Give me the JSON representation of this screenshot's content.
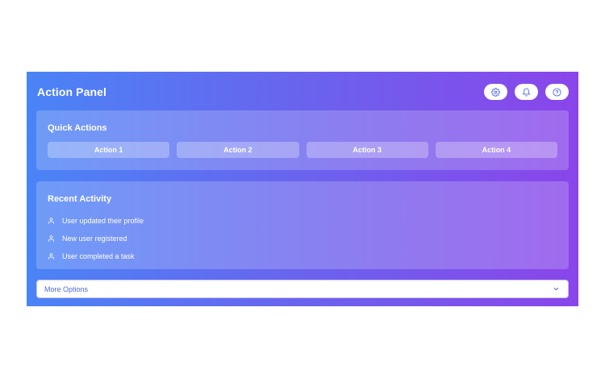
{
  "panel": {
    "title": "Action Panel",
    "header_icons": [
      "gear-icon",
      "bell-icon",
      "help-icon"
    ]
  },
  "quick_actions": {
    "title": "Quick Actions",
    "buttons": [
      "Action 1",
      "Action 2",
      "Action 3",
      "Action 4"
    ]
  },
  "recent_activity": {
    "title": "Recent Activity",
    "items": [
      "User updated their profile",
      "New user registered",
      "User completed a task"
    ]
  },
  "more_options": {
    "label": "More Options"
  },
  "colors": {
    "gradient_start": "#4a84f6",
    "gradient_end": "#8a45ea",
    "accent": "#4f6bdc"
  }
}
